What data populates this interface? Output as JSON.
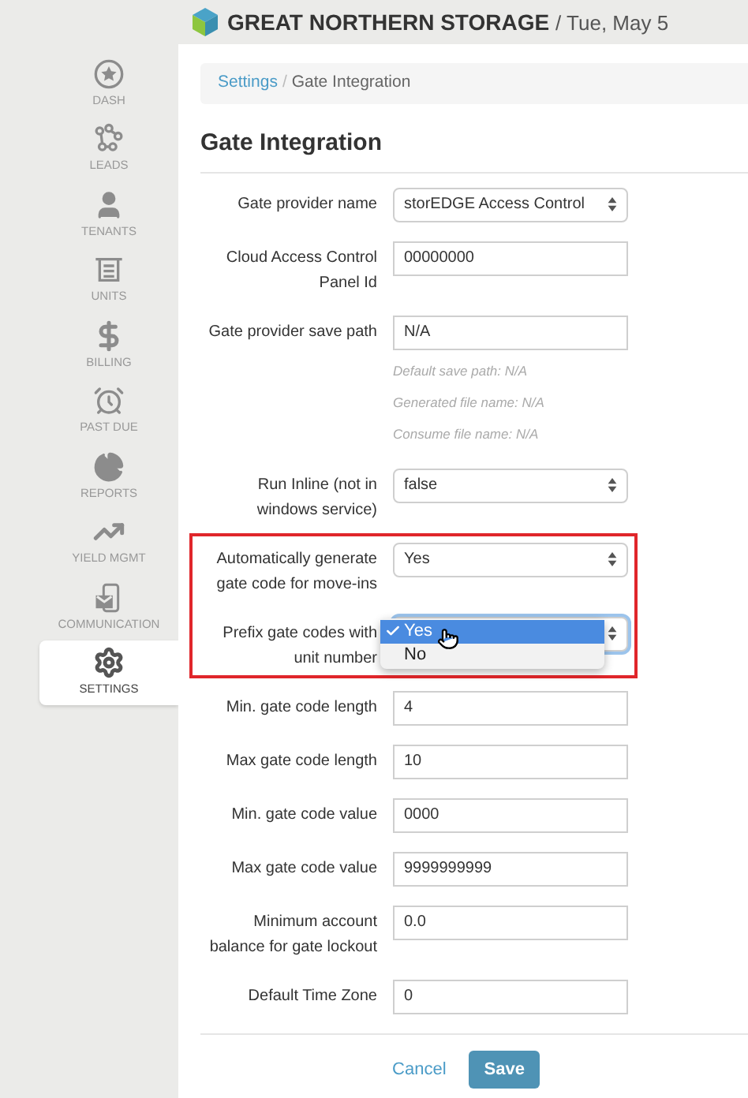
{
  "header": {
    "brand": "GREAT NORTHERN STORAGE",
    "date": "/ Tue, May 5"
  },
  "sidebar": {
    "items": [
      {
        "label": "DASH",
        "kind": "dash",
        "selected": false
      },
      {
        "label": "LEADS",
        "kind": "leads",
        "selected": false
      },
      {
        "label": "TENANTS",
        "kind": "tenants",
        "selected": false
      },
      {
        "label": "UNITS",
        "kind": "units",
        "selected": false
      },
      {
        "label": "BILLING",
        "kind": "billing",
        "selected": false
      },
      {
        "label": "PAST DUE",
        "kind": "pastdue",
        "selected": false
      },
      {
        "label": "REPORTS",
        "kind": "reports",
        "selected": false
      },
      {
        "label": "YIELD MGMT",
        "kind": "yield",
        "selected": false
      },
      {
        "label": "COMMUNICATION",
        "kind": "communication",
        "selected": false
      },
      {
        "label": "SETTINGS",
        "kind": "settings",
        "selected": true
      }
    ]
  },
  "breadcrumb": {
    "link": "Settings",
    "separator": "/",
    "current": "Gate Integration"
  },
  "title": "Gate Integration",
  "sections": [
    {
      "highlighted": false,
      "fields": [
        {
          "kind": "select",
          "label": "Gate provider name",
          "value": "storEDGE Access Control"
        },
        {
          "kind": "text",
          "label": "Cloud Access Control\nPanel Id",
          "value": "00000000"
        },
        {
          "kind": "text",
          "label": "Gate provider save path",
          "value": "N/A",
          "hints": [
            "Default save path: N/A",
            "Generated file name: N/A",
            "Consume file name: N/A"
          ]
        },
        {
          "kind": "select",
          "label": "Run Inline (not in\nwindows service)",
          "value": "false"
        }
      ]
    },
    {
      "highlighted": true,
      "fields": [
        {
          "kind": "select",
          "label": "Automatically generate\ngate code for move-ins",
          "value": "Yes"
        },
        {
          "kind": "open_select",
          "label": "Prefix gate codes with\nunit number",
          "options": [
            {
              "label": "Yes",
              "selected": true
            },
            {
              "label": "No",
              "selected": false
            }
          ]
        }
      ]
    },
    {
      "highlighted": false,
      "fields": [
        {
          "kind": "text",
          "label": "Min. gate code length",
          "value": "4"
        },
        {
          "kind": "text",
          "label": "Max gate code length",
          "value": "10"
        },
        {
          "kind": "text",
          "label": "Min. gate code value",
          "value": "0000"
        },
        {
          "kind": "text",
          "label": "Max gate code value",
          "value": "9999999999"
        },
        {
          "kind": "text",
          "label": "Minimum account\nbalance for gate lockout",
          "value": "0.0"
        },
        {
          "kind": "text",
          "label": "Default Time Zone",
          "value": "0"
        }
      ]
    }
  ],
  "actions": {
    "cancel": "Cancel",
    "save": "Save"
  }
}
